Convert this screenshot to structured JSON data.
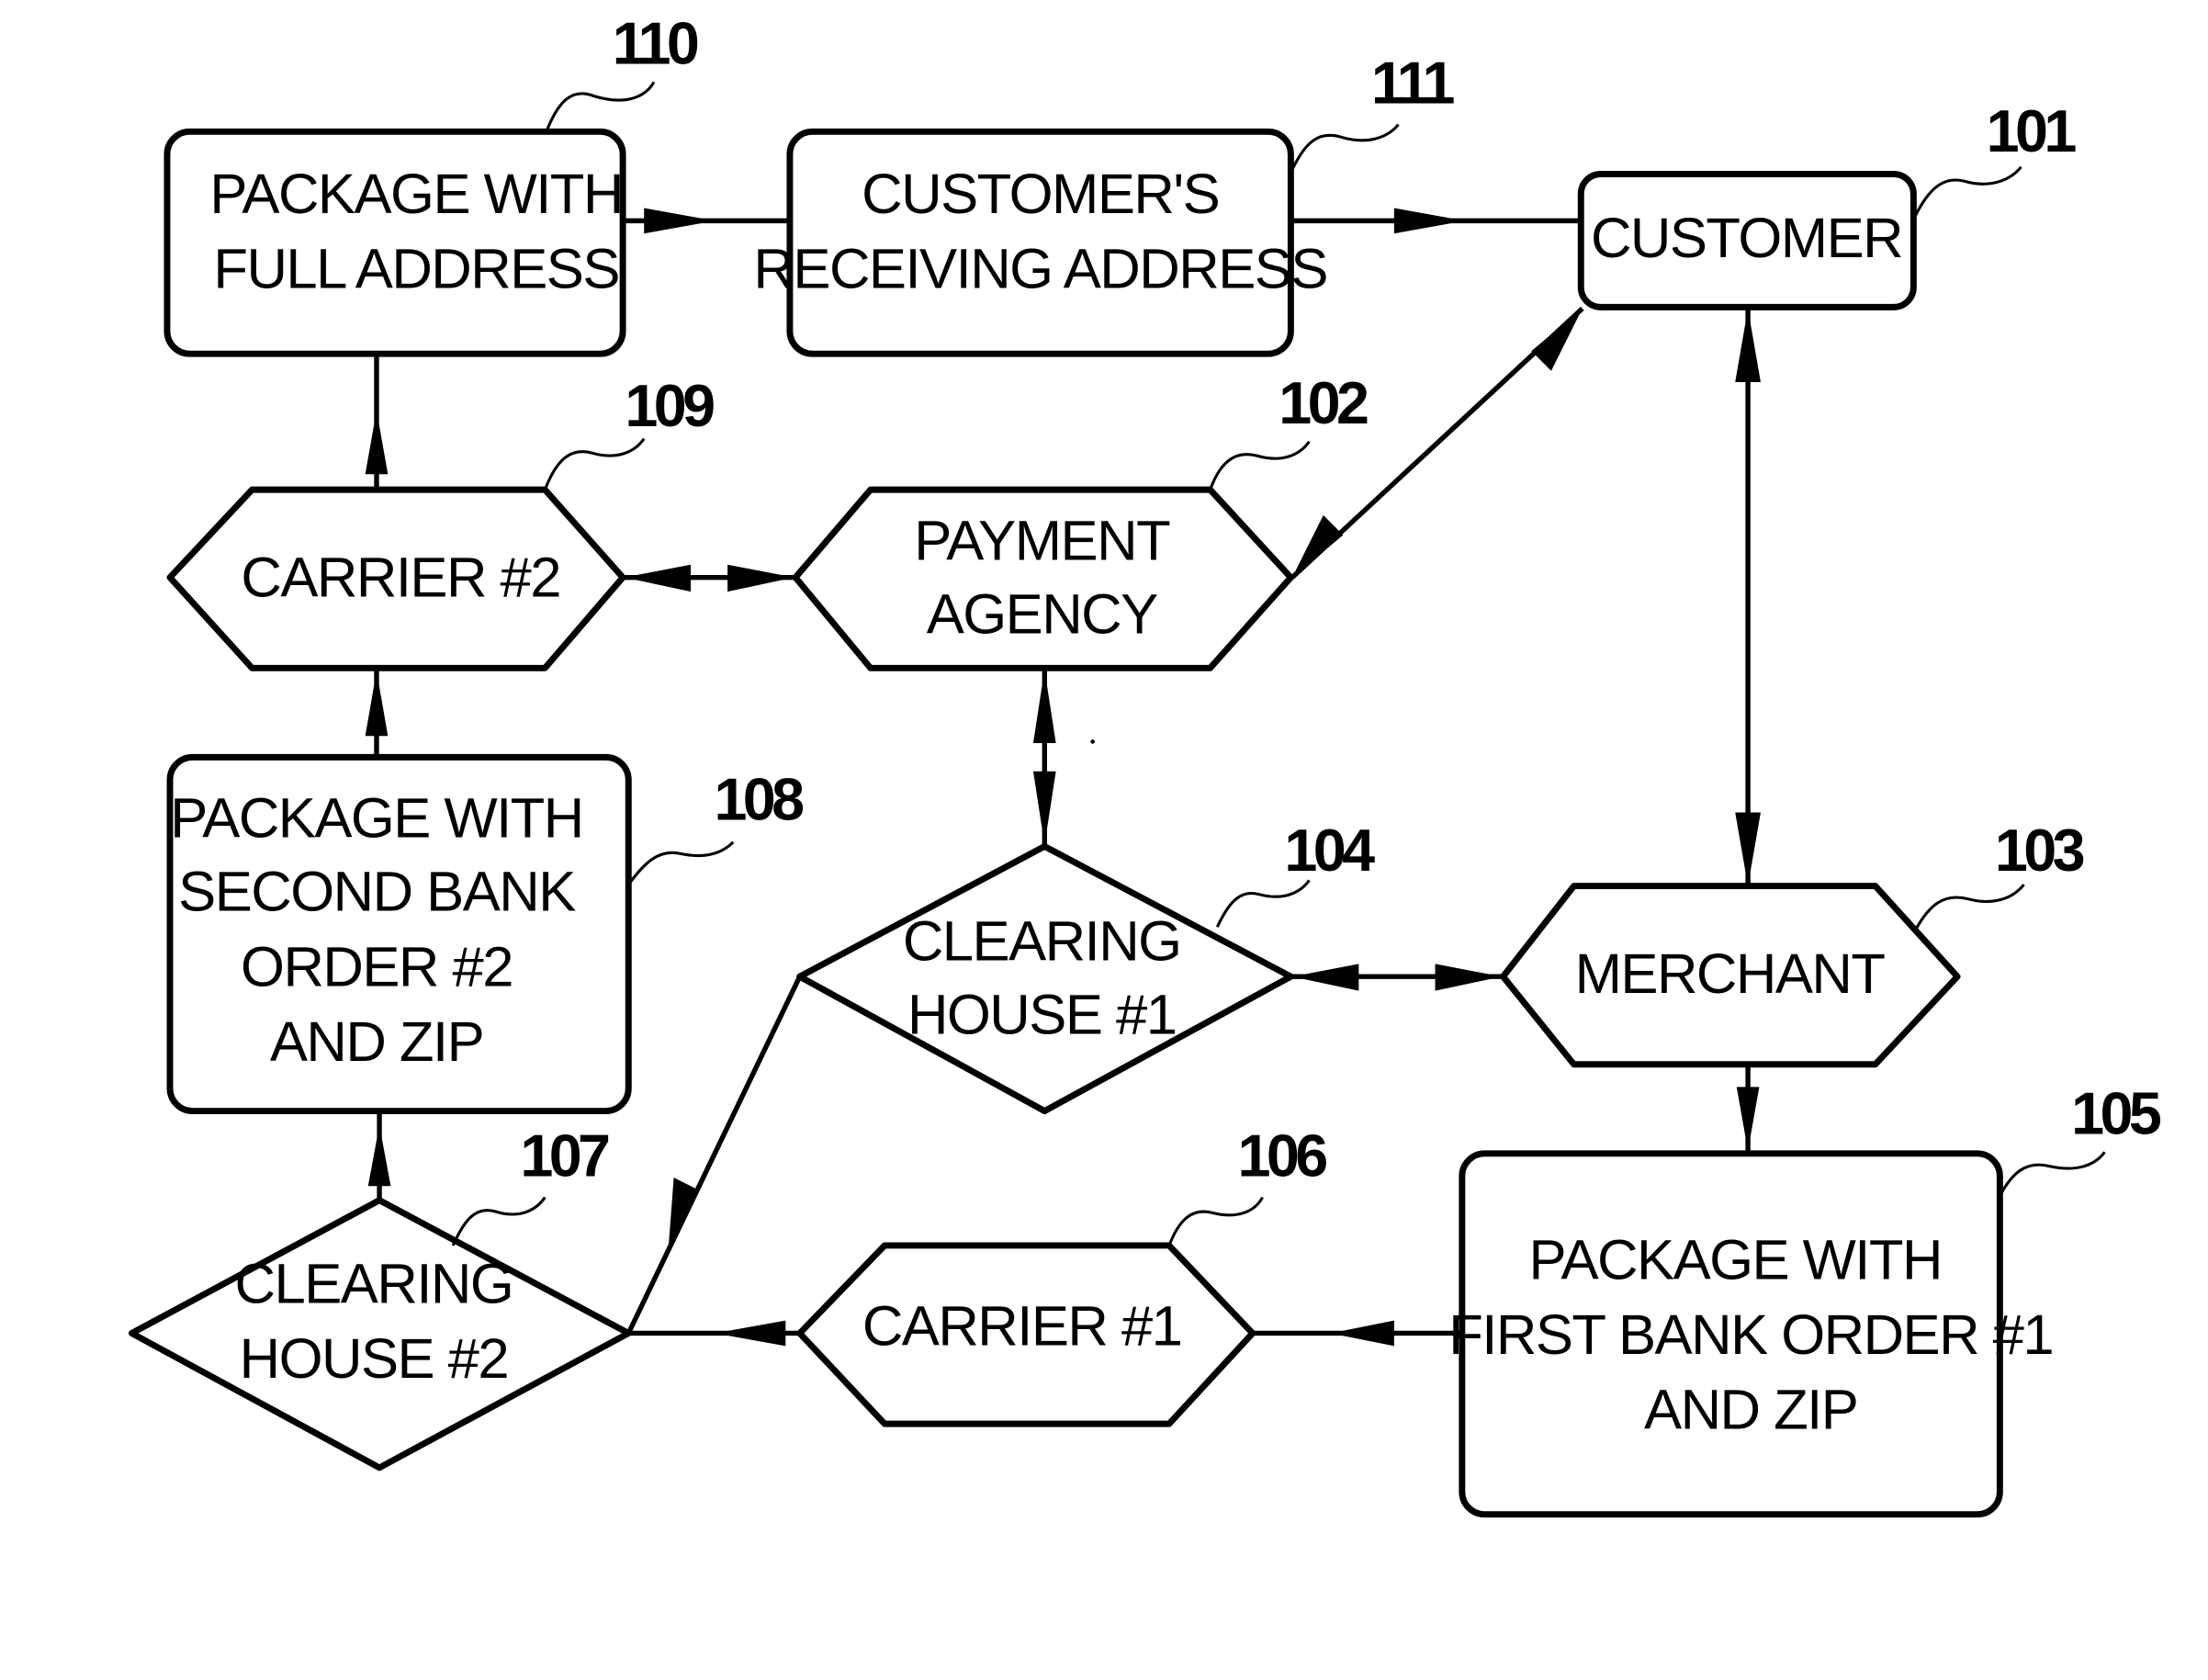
{
  "figure": {
    "nodes": {
      "n110": {
        "ref": "110",
        "shape": "rounded-box",
        "lines": [
          "PACKAGE  WITH",
          "FULL  ADDRESS"
        ]
      },
      "n111": {
        "ref": "111",
        "shape": "rounded-box",
        "lines": [
          "CUSTOMER'S",
          "RECEIVING  ADDRESS"
        ]
      },
      "n101": {
        "ref": "101",
        "shape": "rounded-box",
        "lines": [
          "CUSTOMER"
        ]
      },
      "n109": {
        "ref": "109",
        "shape": "hexagon",
        "lines": [
          "CARRIER  #2"
        ]
      },
      "n102": {
        "ref": "102",
        "shape": "hexagon",
        "lines": [
          "PAYMENT",
          "AGENCY"
        ]
      },
      "n108": {
        "ref": "108",
        "shape": "rounded-box",
        "lines": [
          "PACKAGE  WITH",
          "SECOND  BANK",
          "ORDER  #2",
          "AND  ZIP"
        ]
      },
      "n104": {
        "ref": "104",
        "shape": "diamond",
        "lines": [
          "CLEARING",
          "HOUSE  #1"
        ]
      },
      "n103": {
        "ref": "103",
        "shape": "hexagon",
        "lines": [
          "MERCHANT"
        ]
      },
      "n107": {
        "ref": "107",
        "shape": "diamond",
        "lines": [
          "CLEARING",
          "HOUSE  #2"
        ]
      },
      "n106": {
        "ref": "106",
        "shape": "hexagon",
        "lines": [
          "CARRIER  #1"
        ]
      },
      "n105": {
        "ref": "105",
        "shape": "rounded-box",
        "lines": [
          "PACKAGE  WITH",
          "FIRST  BANK  ORDER  #1",
          "AND  ZIP"
        ]
      }
    },
    "edges": [
      {
        "from": "110",
        "to": "111",
        "direction": "forward"
      },
      {
        "from": "111",
        "to": "101",
        "direction": "forward"
      },
      {
        "from": "101",
        "to": "102",
        "direction": "both"
      },
      {
        "from": "101",
        "to": "103",
        "direction": "both"
      },
      {
        "from": "109",
        "to": "102",
        "direction": "both"
      },
      {
        "from": "109",
        "to": "110",
        "direction": "forward"
      },
      {
        "from": "108",
        "to": "109",
        "direction": "forward"
      },
      {
        "from": "102",
        "to": "104",
        "direction": "both"
      },
      {
        "from": "104",
        "to": "103",
        "direction": "both"
      },
      {
        "from": "104",
        "to": "107",
        "direction": "forward"
      },
      {
        "from": "103",
        "to": "105",
        "direction": "forward"
      },
      {
        "from": "105",
        "to": "106",
        "direction": "forward"
      },
      {
        "from": "106",
        "to": "107",
        "direction": "forward"
      },
      {
        "from": "107",
        "to": "108",
        "direction": "forward"
      }
    ]
  }
}
